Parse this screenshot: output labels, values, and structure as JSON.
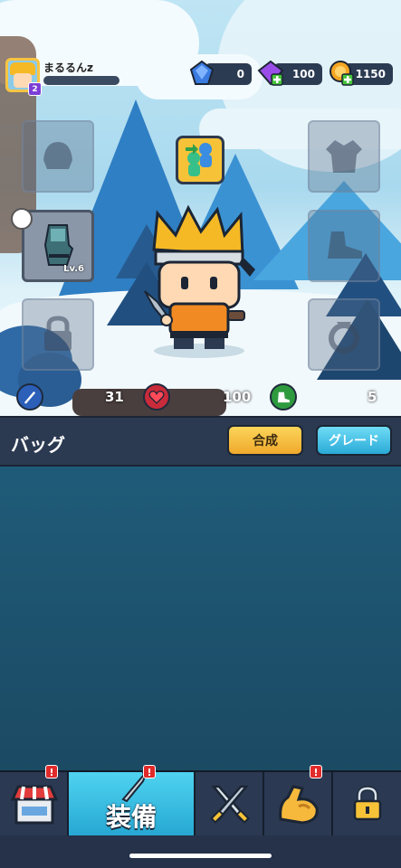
{
  "player": {
    "name": "まるるんz",
    "level": "2"
  },
  "resources": {
    "blue_gem": "0",
    "purple_gem": "100",
    "gold_coin": "1150"
  },
  "equipment": {
    "gloves_level": "Lv.6"
  },
  "stats": {
    "attack": "31",
    "health": "100",
    "speed": "5"
  },
  "bag": {
    "title": "バッグ",
    "merge_label": "合成",
    "grade_label": "グレード"
  },
  "nav": {
    "equip_label": "装備",
    "alert_mark": "!"
  },
  "colors": {
    "accent_yellow": "#f6c338",
    "accent_cyan": "#2aaad8",
    "panel_dark": "#2c3a51",
    "bag_bg": "#1f5b79"
  }
}
